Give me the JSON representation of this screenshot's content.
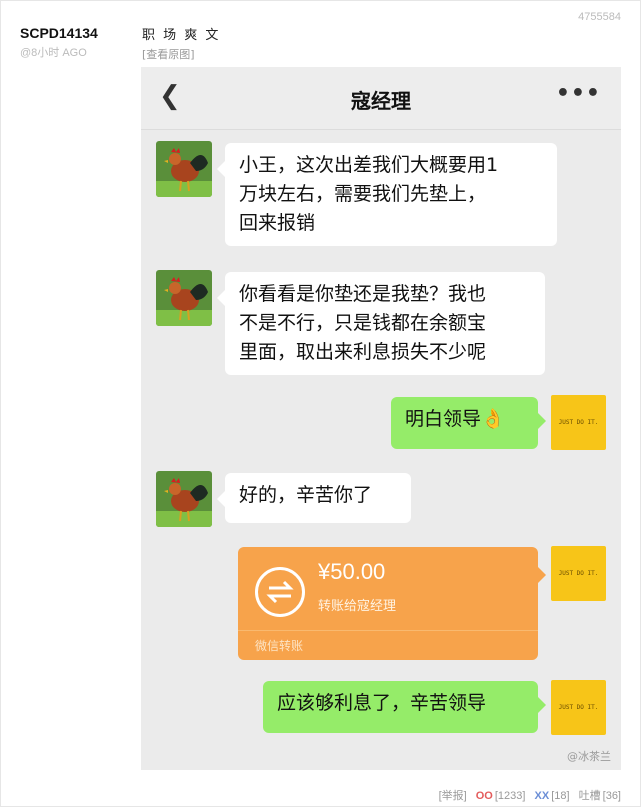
{
  "post": {
    "author": "SCPD14134",
    "time": "@8小时 AGO",
    "id": "4755584",
    "title": "职 场 爽 文",
    "view_original": "[查看原图]"
  },
  "chat": {
    "title": "寇经理",
    "back_icon": "chevron-left-icon",
    "more_icon": "more-dots-icon",
    "more_label": "•••",
    "self_avatar_text": "JUST DO IT.",
    "messages": [
      {
        "side": "left",
        "lines": [
          "小王，这次出差我们大概要用1",
          "万块左右，需要我们先垫上，",
          "回来报销"
        ]
      },
      {
        "side": "left",
        "lines": [
          "你看看是你垫还是我垫？我也",
          "不是不行，只是钱都在余额宝",
          "里面，取出来利息损失不少呢"
        ]
      },
      {
        "side": "right",
        "text": "明白领导",
        "emoji": "👌"
      },
      {
        "side": "left",
        "text": "好的，辛苦你了"
      },
      {
        "side": "right",
        "text": "应该够利息了，辛苦领导"
      }
    ],
    "transfer": {
      "amount": "¥50.00",
      "desc": "转账给寇经理",
      "footer": "微信转账"
    },
    "watermark": "@冰茶兰"
  },
  "footer": {
    "report": "[举报]",
    "oo_label": "OO",
    "oo_count": "[1233]",
    "xx_label": "XX",
    "xx_count": "[18]",
    "comment_label": "吐槽",
    "comment_count": "[36]"
  },
  "colors": {
    "bubble_green": "#95ec69",
    "transfer_orange": "#f7a34b",
    "self_avatar_yellow": "#f7c518"
  }
}
